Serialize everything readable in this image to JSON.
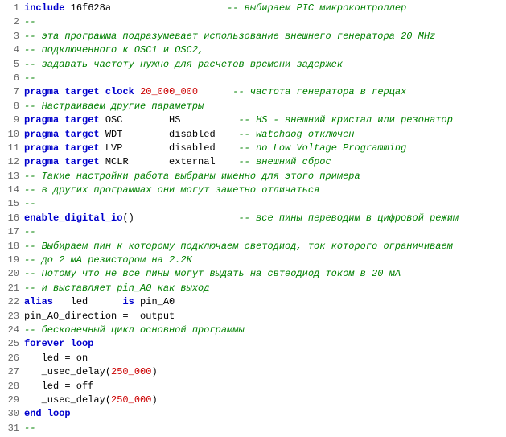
{
  "lines": [
    {
      "num": 1,
      "content": [
        {
          "t": "kw",
          "v": "include"
        },
        {
          "t": "plain",
          "v": " 16f628a                    "
        },
        {
          "t": "comment",
          "v": "-- выбираем PIC микроконтроллер"
        }
      ]
    },
    {
      "num": 2,
      "content": [
        {
          "t": "comment",
          "v": "--"
        }
      ]
    },
    {
      "num": 3,
      "content": [
        {
          "t": "comment",
          "v": "-- эта программа подразумевает использование внешнего генератора 20 MHz"
        }
      ]
    },
    {
      "num": 4,
      "content": [
        {
          "t": "comment",
          "v": "-- подключенного к OSC1 и OSC2,"
        }
      ]
    },
    {
      "num": 5,
      "content": [
        {
          "t": "comment",
          "v": "-- задавать частоту нужно для расчетов времени задержек"
        }
      ]
    },
    {
      "num": 6,
      "content": [
        {
          "t": "comment",
          "v": "--"
        }
      ]
    },
    {
      "num": 7,
      "content": [
        {
          "t": "kw",
          "v": "pragma"
        },
        {
          "t": "plain",
          "v": " "
        },
        {
          "t": "kw",
          "v": "target"
        },
        {
          "t": "plain",
          "v": " "
        },
        {
          "t": "kw",
          "v": "clock"
        },
        {
          "t": "plain",
          "v": " "
        },
        {
          "t": "num",
          "v": "20_000_000"
        },
        {
          "t": "plain",
          "v": "      "
        },
        {
          "t": "comment",
          "v": "-- частота генератора в герцах"
        }
      ]
    },
    {
      "num": 8,
      "content": [
        {
          "t": "comment",
          "v": "-- Настраиваем другие параметры"
        }
      ]
    },
    {
      "num": 9,
      "content": [
        {
          "t": "kw",
          "v": "pragma"
        },
        {
          "t": "plain",
          "v": " "
        },
        {
          "t": "kw",
          "v": "target"
        },
        {
          "t": "plain",
          "v": " OSC        HS          "
        },
        {
          "t": "comment",
          "v": "-- HS - внешний кристал или резонатор"
        }
      ]
    },
    {
      "num": 10,
      "content": [
        {
          "t": "kw",
          "v": "pragma"
        },
        {
          "t": "plain",
          "v": " "
        },
        {
          "t": "kw",
          "v": "target"
        },
        {
          "t": "plain",
          "v": " WDT        disabled    "
        },
        {
          "t": "comment",
          "v": "-- watchdog отключен"
        }
      ]
    },
    {
      "num": 11,
      "content": [
        {
          "t": "kw",
          "v": "pragma"
        },
        {
          "t": "plain",
          "v": " "
        },
        {
          "t": "kw",
          "v": "target"
        },
        {
          "t": "plain",
          "v": " LVP        disabled    "
        },
        {
          "t": "comment",
          "v": "-- no Low Voltage Programming"
        }
      ]
    },
    {
      "num": 12,
      "content": [
        {
          "t": "kw",
          "v": "pragma"
        },
        {
          "t": "plain",
          "v": " "
        },
        {
          "t": "kw",
          "v": "target"
        },
        {
          "t": "plain",
          "v": " MCLR       external    "
        },
        {
          "t": "comment",
          "v": "-- внешний сброс"
        }
      ]
    },
    {
      "num": 13,
      "content": [
        {
          "t": "comment",
          "v": "-- Такие настройки работа выбраны именно для этого примера"
        }
      ]
    },
    {
      "num": 14,
      "content": [
        {
          "t": "comment",
          "v": "-- в других программах они могут заметно отличаться"
        }
      ]
    },
    {
      "num": 15,
      "content": [
        {
          "t": "comment",
          "v": "--"
        }
      ]
    },
    {
      "num": 16,
      "content": [
        {
          "t": "kw",
          "v": "enable_digital_io"
        },
        {
          "t": "plain",
          "v": "()                  "
        },
        {
          "t": "comment",
          "v": "-- все пины переводим в цифровой режим"
        }
      ]
    },
    {
      "num": 17,
      "content": [
        {
          "t": "comment",
          "v": "--"
        }
      ]
    },
    {
      "num": 18,
      "content": [
        {
          "t": "comment",
          "v": "-- Выбираем пин к которому подключаем светодиод, ток которого ограничиваем"
        }
      ]
    },
    {
      "num": 19,
      "content": [
        {
          "t": "comment",
          "v": "-- до 2 мА резистором на 2.2К"
        }
      ]
    },
    {
      "num": 20,
      "content": [
        {
          "t": "comment",
          "v": "-- Потому что не все пины могут выдать на свтеодиод током в 20 мА"
        }
      ]
    },
    {
      "num": 21,
      "content": [
        {
          "t": "comment",
          "v": "-- и выставляет pin_A0 как выход"
        }
      ]
    },
    {
      "num": 22,
      "content": [
        {
          "t": "kw",
          "v": "alias"
        },
        {
          "t": "plain",
          "v": "   led      "
        },
        {
          "t": "kw",
          "v": "is"
        },
        {
          "t": "plain",
          "v": " pin_A0"
        }
      ]
    },
    {
      "num": 23,
      "content": [
        {
          "t": "plain",
          "v": "pin_A0_direction = "
        },
        {
          "t": "plain",
          "v": " output"
        }
      ]
    },
    {
      "num": 24,
      "content": [
        {
          "t": "comment",
          "v": "-- бесконечный цикл основной программы"
        }
      ]
    },
    {
      "num": 25,
      "content": [
        {
          "t": "kw",
          "v": "forever"
        },
        {
          "t": "plain",
          "v": " "
        },
        {
          "t": "kw",
          "v": "loop"
        }
      ]
    },
    {
      "num": 26,
      "content": [
        {
          "t": "plain",
          "v": "   led = on"
        }
      ]
    },
    {
      "num": 27,
      "content": [
        {
          "t": "plain",
          "v": "   _usec_delay("
        },
        {
          "t": "num",
          "v": "250_000"
        },
        {
          "t": "plain",
          "v": ")"
        }
      ]
    },
    {
      "num": 28,
      "content": [
        {
          "t": "plain",
          "v": "   led = off"
        }
      ]
    },
    {
      "num": 29,
      "content": [
        {
          "t": "plain",
          "v": "   _usec_delay("
        },
        {
          "t": "num",
          "v": "250_000"
        },
        {
          "t": "plain",
          "v": ")"
        }
      ]
    },
    {
      "num": 30,
      "content": [
        {
          "t": "kw",
          "v": "end"
        },
        {
          "t": "plain",
          "v": " "
        },
        {
          "t": "kw",
          "v": "loop"
        }
      ]
    },
    {
      "num": 31,
      "content": [
        {
          "t": "comment",
          "v": "--"
        }
      ]
    }
  ]
}
